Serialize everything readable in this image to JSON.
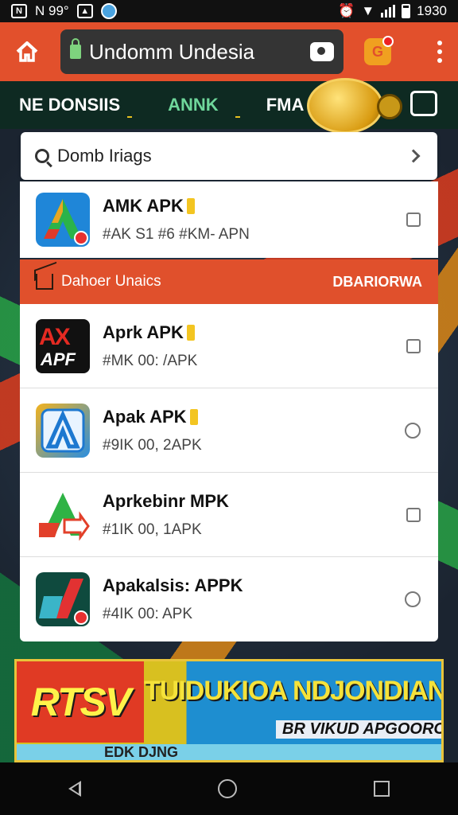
{
  "status_bar": {
    "left_text": "N 99°",
    "time": "1930"
  },
  "app_bar": {
    "url_text": "Undomm Undesia",
    "badge_letter": "G"
  },
  "nav": {
    "tabs": [
      "NE DONSIIS",
      "ANNK",
      "FMA"
    ]
  },
  "search": {
    "text": "Domb Iriags"
  },
  "top_item": {
    "name": "AMK APK",
    "sub": "#AK S1 #6 #KM- APN"
  },
  "section": {
    "title": "Dahoer Unaics",
    "right": "DBARIORWA"
  },
  "items": [
    {
      "name": "Aprk APK",
      "sub": "#MK 00: /APK",
      "icon_text": "AX",
      "icon_text2": "APF"
    },
    {
      "name": "Apak APK",
      "sub": "#9IK 00, 2APK"
    },
    {
      "name": "Aprkebinr MPK",
      "sub": "#1IK 00, 1APK"
    },
    {
      "name": "Apakalsis: APPK",
      "sub": "#4IK 00:  APK"
    }
  ],
  "banner": {
    "big": "RTSV",
    "title": "TUIDUKIOA NDJONDIAN",
    "sub": "BR VIKUD APGOORON",
    "strip": "EDK DJNG"
  },
  "colors": {
    "accent": "#e2502c",
    "nav_bg": "#0e2a22",
    "active_tab": "#6fd79b"
  }
}
